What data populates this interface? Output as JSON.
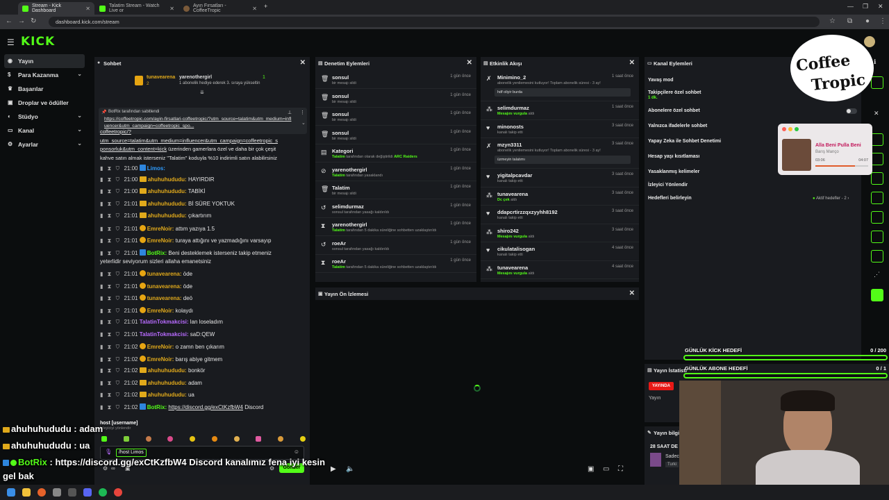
{
  "browser": {
    "tabs": [
      {
        "title": "Stream - Kick Dashboard"
      },
      {
        "title": "Talatim Stream - Watch Live or"
      },
      {
        "title": "Ayın Fırsatları - CoffeeTropic"
      }
    ],
    "url": "dashboard.kick.com/stream"
  },
  "brand": {
    "logo": "KICK",
    "accent": "#53fc18"
  },
  "sidebar": {
    "items": [
      {
        "label": "Yayın",
        "icon": "broadcast-icon"
      },
      {
        "label": "Para Kazanma",
        "icon": "money-icon"
      },
      {
        "label": "Başarılar",
        "icon": "trophy-icon"
      },
      {
        "label": "Droplar ve ödüller",
        "icon": "gift-icon"
      },
      {
        "label": "Stüdyo",
        "icon": "studio-icon"
      },
      {
        "label": "Kanal",
        "icon": "channel-icon"
      },
      {
        "label": "Ayarlar",
        "icon": "settings-icon"
      }
    ]
  },
  "chat": {
    "title": "Sohbet",
    "top_user": "tunavearena",
    "top_user_count": "2",
    "gifter": "yarenothergirl",
    "gifter_count": "1",
    "gift_text": "1 abonelik hediye ederek 3. sıraya yükseltin",
    "pinned_header": "BotRix tarafından sabitlendi",
    "pinned_link": "https://coffeetropic.com/ayin-firsatlari-coffeetropic/?utm_source=talatim&utm_medium=influencer&utm_campaign=coffeetropic_spo...",
    "promo_link_1": "coffeetropic/?",
    "promo_link_2": "utm_source=talatim&utm_medium=influencer&utm_campaign=coffeetropic_s",
    "promo_link_3": "ponsorluk&utm_content=kick",
    "promo_text_1": " üzerinden gamerlara özel ve daha bir çok çeşit",
    "promo_text_2": "kahve satın almak isterseniz \"Talatim\" koduyla %10 indirimli satın alabilirsiniz",
    "messages": [
      {
        "time": "21:00",
        "user": "Limos:",
        "text": "",
        "color": "#2e9cff"
      },
      {
        "time": "21:00",
        "user": "ahuhuhududu:",
        "text": "HAYIRDIR",
        "color": "#e0a91b"
      },
      {
        "time": "21:00",
        "user": "ahuhuhududu:",
        "text": "TABİKİ",
        "color": "#e0a91b"
      },
      {
        "time": "21:01",
        "user": "ahuhuhududu:",
        "text": "Bİ SÜRE YOKTUK",
        "color": "#e0a91b"
      },
      {
        "time": "21:01",
        "user": "ahuhuhududu:",
        "text": "çıkartırım",
        "color": "#e0a91b"
      },
      {
        "time": "21:01",
        "user": "EmreNoir:",
        "text": "attım yazıya 1.5",
        "color": "#e0a91b"
      },
      {
        "time": "21:01",
        "user": "EmreNoir:",
        "text": "turaya attığını ve yazmadığını varsayıp",
        "color": "#e0a91b"
      },
      {
        "time": "21:01",
        "user": "BotRix:",
        "text": "Beni desteklemek isterseniz takip etmeniz",
        "color": "#53fc18"
      },
      {
        "time": "",
        "user": "",
        "text": "yeterlidir seviyorum sizleri allaha emanetsiniz",
        "color": "#e0a91b"
      },
      {
        "time": "21:01",
        "user": "tunavearena:",
        "text": "öde",
        "color": "#e0a91b"
      },
      {
        "time": "21:01",
        "user": "tunavearena:",
        "text": "öde",
        "color": "#e0a91b"
      },
      {
        "time": "21:01",
        "user": "tunavearena:",
        "text": "deö",
        "color": "#e0a91b"
      },
      {
        "time": "21:01",
        "user": "EmreNoir:",
        "text": "kolaydı",
        "color": "#e0a91b"
      },
      {
        "time": "21:01",
        "user": "TalatinTokmakcisi:",
        "text": "lan loseladım",
        "color": "#b86bff"
      },
      {
        "time": "21:01",
        "user": "TalatinTokmakcisi:",
        "text": "saD:QEW",
        "color": "#b86bff"
      },
      {
        "time": "21:02",
        "user": "EmreNoir:",
        "text": "o zamn ben çıkarım",
        "color": "#e0a91b"
      },
      {
        "time": "21:02",
        "user": "EmreNoir:",
        "text": "barış abiye gitmem",
        "color": "#e0a91b"
      },
      {
        "time": "21:02",
        "user": "ahuhuhududu:",
        "text": "bonkör",
        "color": "#e0a91b"
      },
      {
        "time": "21:02",
        "user": "ahuhuhududu:",
        "text": "adam",
        "color": "#e0a91b"
      },
      {
        "time": "21:02",
        "user": "ahuhuhududu:",
        "text": "ua",
        "color": "#e0a91b"
      },
      {
        "time": "21:02",
        "user": "BotRix:",
        "text": "Discord",
        "color": "#53fc18"
      }
    ],
    "botrix_link": "https://discord.gg/exCtKzfbW4",
    "command_hint": "host [username]",
    "command_hint_sub": "İzleyiciyi yönlendir",
    "input_value": "/host Limos",
    "send_label": "Gönder"
  },
  "moderation": {
    "title": "Denetim Eylemleri",
    "rows": [
      {
        "icon": "trash-icon",
        "name": "sonsul",
        "sub_pre": "",
        "sub_green": "",
        "sub": "bir mesajı sildi",
        "time": "1 gün önce"
      },
      {
        "icon": "trash-icon",
        "name": "sonsul",
        "sub_pre": "",
        "sub_green": "",
        "sub": "bir mesajı sildi",
        "time": "1 gün önce"
      },
      {
        "icon": "trash-icon",
        "name": "sonsul",
        "sub_pre": "",
        "sub_green": "",
        "sub": "bir mesajı sildi",
        "time": "1 gün önce"
      },
      {
        "icon": "trash-icon",
        "name": "sonsul",
        "sub_pre": "",
        "sub_green": "",
        "sub": "bir mesajı sildi",
        "time": "1 gün önce"
      },
      {
        "icon": "category-icon",
        "name": "Kategori",
        "sub_pre": "Talatim",
        "sub_green": "ARC Raiders",
        "sub": " tarafından  olarak değiştirildi",
        "time": "1 gün önce"
      },
      {
        "icon": "ban-icon",
        "name": "yarenothergirl",
        "sub_pre": "Talatim",
        "sub_green": "",
        "sub": " tarafından yasaklandı",
        "time": "1 gün önce"
      },
      {
        "icon": "trash-icon",
        "name": "Talatim",
        "sub_pre": "",
        "sub_green": "",
        "sub": "bir mesajı sildi",
        "time": "1 gün önce"
      },
      {
        "icon": "unban-icon",
        "name": "selimdurmaz",
        "sub_pre": "",
        "sub_green": "",
        "sub": "sonsul tarafından yasağı kaldırıldı",
        "time": "1 gün önce"
      },
      {
        "icon": "timeout-icon",
        "name": "yarenothergirl",
        "sub_pre": "Talatim",
        "sub_green": "",
        "sub": " tarafından 5 dakika süreliğine sohbetten uzaklaştırıldı",
        "time": "1 gün önce"
      },
      {
        "icon": "unban-icon",
        "name": "roeAr",
        "sub_pre": "",
        "sub_green": "",
        "sub": "sonsul tarafından yasağı kaldırıldı",
        "time": "1 gün önce"
      },
      {
        "icon": "timeout-icon",
        "name": "roeAr",
        "sub_pre": "Talatim",
        "sub_green": "",
        "sub": " tarafından 5 dakika süreliğine sohbetten uzaklaştırıldı",
        "time": "1 gün önce"
      }
    ]
  },
  "activity": {
    "title": "Etkinlik Akışı",
    "rows": [
      {
        "icon": "kick-icon",
        "name": "Minimino_2",
        "sub": "abonelik yenilemesini kutluyor! Toplam abonelik süresi - 3 ay!",
        "time": "1 saat önce",
        "quote": "hdf oliyir burda"
      },
      {
        "icon": "boost-icon",
        "name": "selimdurmaz",
        "sub_green": "Mesajını vurgula",
        "sub": " aldı",
        "time": "1 saat önce"
      },
      {
        "icon": "heart-icon",
        "name": "minonosts",
        "sub": "kanalı takip etti",
        "time": "3 saat önce"
      },
      {
        "icon": "kick-icon",
        "name": "mzyn3311",
        "sub": "abonelik yenilemesini kutluyor! Toplam abonelik süresi - 3 ay!",
        "time": "3 saat önce",
        "quote": "üzmeyin talatımı"
      },
      {
        "icon": "heart-icon",
        "name": "yigitalpcavdar",
        "sub": "kanalı takip etti",
        "time": "3 saat önce"
      },
      {
        "icon": "boost-icon",
        "name": "tunavearena",
        "sub_green": "Dc çek",
        "sub": " aldı",
        "time": "3 saat önce"
      },
      {
        "icon": "heart-icon",
        "name": "ddapcrtirzzqxzyyhh8192",
        "sub": "kanalı takip etti",
        "time": "3 saat önce"
      },
      {
        "icon": "boost-icon",
        "name": "shiro242",
        "sub_green": "Mesajını vurgula",
        "sub": " aldı",
        "time": "3 saat önce"
      },
      {
        "icon": "heart-icon",
        "name": "cikulatalisogan",
        "sub": "kanalı takip etti",
        "time": "4 saat önce"
      },
      {
        "icon": "boost-icon",
        "name": "tunavearena",
        "sub_green": "Mesajını vurgula",
        "sub": " aldı",
        "time": "4 saat önce"
      }
    ]
  },
  "channel_actions": {
    "title": "Kanal Eylemleri",
    "items": [
      {
        "label": "Yavaş mod"
      },
      {
        "label": "Takipçilere özel sohbet",
        "sub": "1 dk."
      },
      {
        "label": "Abonelere özel sohbet"
      },
      {
        "label": "Yalnızca ifadelerle sohbet"
      },
      {
        "label": "Yapay Zeka ile Sohbet Denetimi"
      },
      {
        "label": "Hesap yaşı kısıtlaması"
      },
      {
        "label": "Yasaklanmış kelimeler"
      },
      {
        "label": "İzleyici Yönlendir"
      },
      {
        "label": "Hedefleri belirleyin"
      }
    ],
    "goals_status": "Aktif hedefler - 2"
  },
  "preview": {
    "title": "Yayın Ön İzlemesi"
  },
  "stats": {
    "title": "Yayın İstatisti",
    "live_badge": "YAYINDA",
    "label": "Yayın"
  },
  "stream_info": {
    "title": "Yayın bilgi",
    "line1": "28 SAAT DE",
    "line2": "Sadec",
    "line3": "Turki"
  },
  "overlays": {
    "goal1_label": "GÜNLÜK KİCK HEDEFİ",
    "goal1_value": "0 / 200",
    "goal1_progress": 0,
    "goal2_label": "GÜNLÜK ABONE HEDEFİ",
    "goal2_value": "0 / 1",
    "goal2_progress": 0,
    "sponsor_line1": "Coffee",
    "sponsor_line2": "Tropic",
    "music_title": "Alla Beni Pulla Beni",
    "music_artist": "Barış Manço",
    "music_elapsed": "03:06",
    "music_total": "04:07",
    "music_progress": 0.75,
    "chat_lines": [
      {
        "user": "ahuhuhududu",
        "text": " : adam"
      },
      {
        "user": "ahuhuhududu",
        "text": " : ua"
      },
      {
        "user": "BotRix",
        "text": " : https://discord.gg/exCtKzfbW4 Discord kanalımız fena iyi kesin"
      },
      {
        "user": "",
        "text": "gel bak"
      }
    ]
  }
}
